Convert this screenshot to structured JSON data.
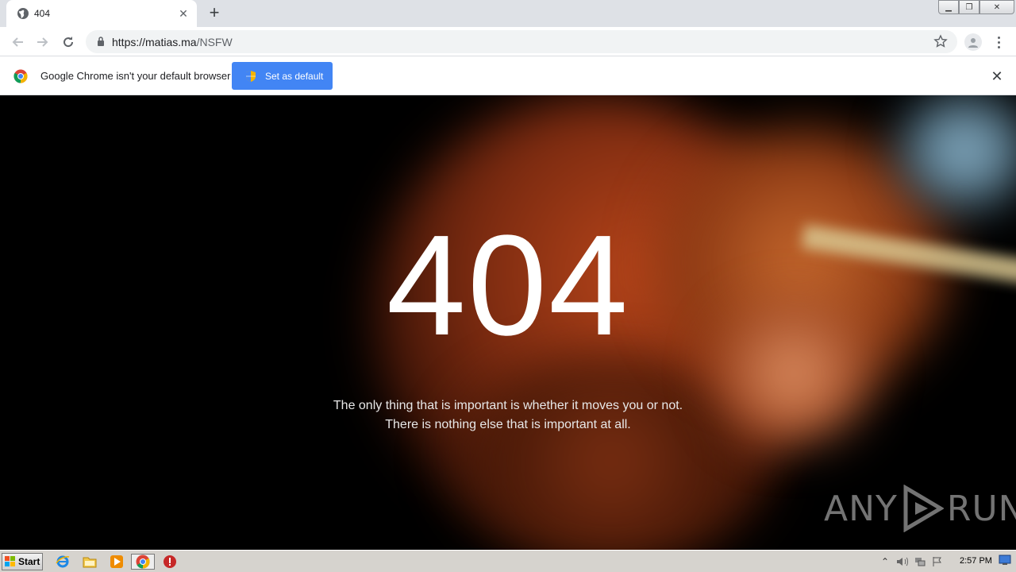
{
  "browser": {
    "tab_title": "404",
    "url_host": "https://matias.ma",
    "url_path": "/NSFW"
  },
  "infobar": {
    "message": "Google Chrome isn't your default browser",
    "button_label": "Set as default"
  },
  "page": {
    "heading": "404",
    "quote_line1": "The only thing that is important is whether it moves you or not.",
    "quote_line2": "There is nothing else that is important at all."
  },
  "watermark": {
    "left": "ANY",
    "right": "RUN"
  },
  "taskbar": {
    "start_label": "Start",
    "clock": "2:57 PM"
  },
  "colors": {
    "accent": "#4285f4",
    "page_background": "#000000"
  }
}
